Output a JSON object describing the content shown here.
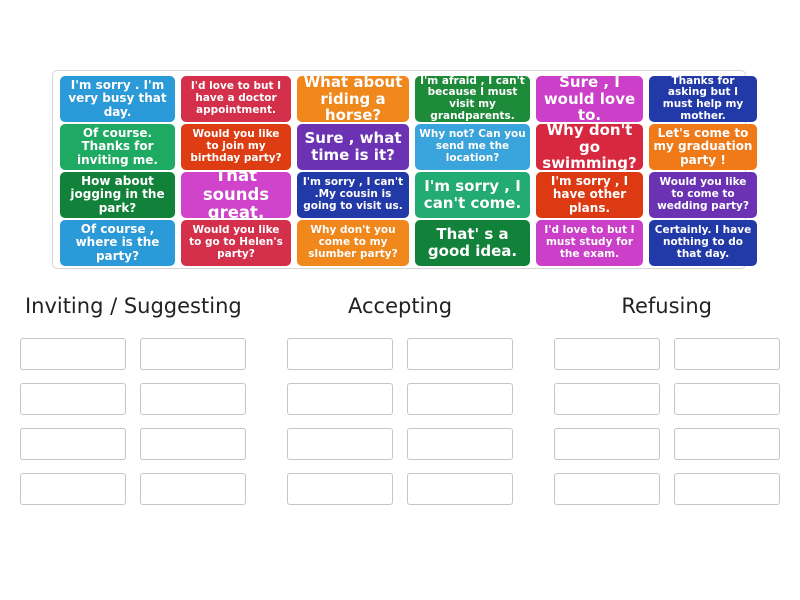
{
  "activity": {
    "type": "group-sort",
    "headings": [
      {
        "label": "Inviting / Suggesting"
      },
      {
        "label": "Accepting"
      },
      {
        "label": "Refusing"
      }
    ],
    "slot_rows": 4,
    "slots_per_row": 2
  },
  "colors": {
    "blue": "#2b9ad9",
    "crimson": "#d5304b",
    "orange": "#f0881c",
    "dark_green": "#1d8b3a",
    "magenta": "#cc3fc8",
    "navy": "#2239a8",
    "emerald": "#21a濃"
  },
  "tiles": {
    "rows": [
      [
        {
          "text": "I'm sorry . I'm very busy that day.",
          "color": "#2b9ad9",
          "size": "fs-md",
          "width": "w1"
        },
        {
          "text": "I'd love to but I have a doctor appointment.",
          "color": "#d5304b",
          "size": "fs-sm",
          "width": "w2"
        },
        {
          "text": "What about riding a horse?",
          "color": "#f0881c",
          "size": "fs-lg",
          "width": "w3"
        },
        {
          "text": "I'm afraid , I can't because I must visit my grandparents.",
          "color": "#1d8b3a",
          "size": "fs-sm",
          "width": "w4"
        },
        {
          "text": "Sure , I would love to.",
          "color": "#cc3fc8",
          "size": "fs-lg",
          "width": "w5"
        },
        {
          "text": "Thanks for asking but I must help my mother.",
          "color": "#2239a8",
          "size": "fs-sm",
          "width": "w6"
        }
      ],
      [
        {
          "text": "Of course. Thanks for inviting me.",
          "color": "#1faa63",
          "size": "fs-md",
          "width": "w1"
        },
        {
          "text": "Would you like to join my birthday party?",
          "color": "#de3d13",
          "size": "fs-sm",
          "width": "w2"
        },
        {
          "text": "Sure , what time is it?",
          "color": "#6b32b4",
          "size": "fs-lg",
          "width": "w3"
        },
        {
          "text": "Why not? Can you send me the location?",
          "color": "#3aa5dc",
          "size": "fs-sm",
          "width": "w4"
        },
        {
          "text": "Why don't go swimming?",
          "color": "#d8283f",
          "size": "fs-lg",
          "width": "w5"
        },
        {
          "text": "Let's come to my graduation party !",
          "color": "#f07a18",
          "size": "fs-md",
          "width": "w6"
        }
      ],
      [
        {
          "text": "How about jogging in the park?",
          "color": "#12823a",
          "size": "fs-md",
          "width": "w1"
        },
        {
          "text": "That sounds great.",
          "color": "#d044cc",
          "size": "fs-xl",
          "width": "w2"
        },
        {
          "text": "I'm sorry , I can't .My cousin is going to visit us.",
          "color": "#2239a8",
          "size": "fs-sm",
          "width": "w3"
        },
        {
          "text": "I'm sorry , I can't come.",
          "color": "#22ab72",
          "size": "fs-lg",
          "width": "w4"
        },
        {
          "text": "I'm sorry , I have other plans.",
          "color": "#dd3a13",
          "size": "fs-md",
          "width": "w5"
        },
        {
          "text": "Would you like to come to wedding party?",
          "color": "#6b32b4",
          "size": "fs-sm",
          "width": "w6"
        }
      ],
      [
        {
          "text": "Of course , where is the party?",
          "color": "#2b9ad9",
          "size": "fs-md",
          "width": "w1"
        },
        {
          "text": "Would you like to go to Helen's party?",
          "color": "#d5304b",
          "size": "fs-sm",
          "width": "w2"
        },
        {
          "text": "Why don't you come to my slumber party?",
          "color": "#f0881c",
          "size": "fs-sm",
          "width": "w3"
        },
        {
          "text": "That' s a good idea.",
          "color": "#12823a",
          "size": "fs-lg",
          "width": "w4"
        },
        {
          "text": "I'd love to but I must study for the exam.",
          "color": "#cc3fc8",
          "size": "fs-sm",
          "width": "w5"
        },
        {
          "text": "Certainly. I have nothing to do that day.",
          "color": "#2239a8",
          "size": "fs-sm",
          "width": "w6"
        }
      ]
    ]
  }
}
